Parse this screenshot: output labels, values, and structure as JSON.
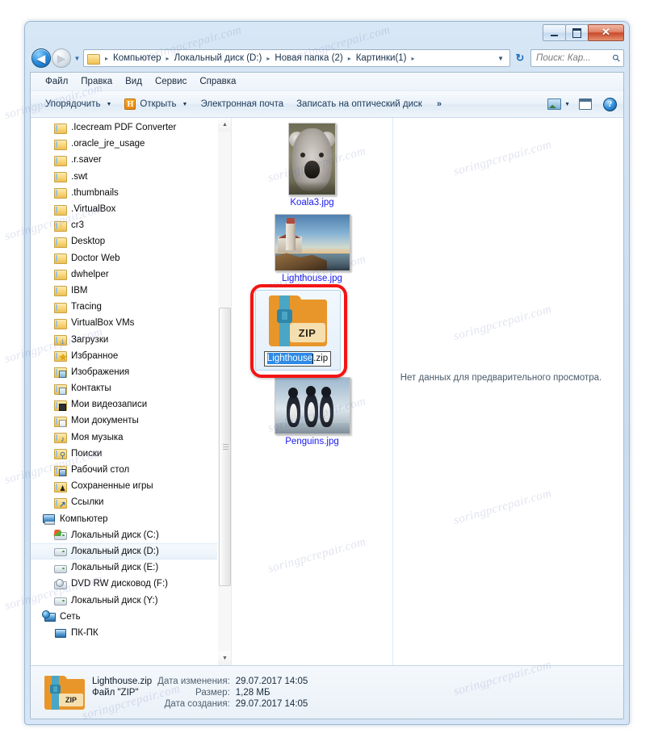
{
  "window": {
    "caption_buttons": {
      "minimize": "—",
      "maximize": "❐",
      "close": "✕"
    }
  },
  "address": {
    "back_arrow": "◀",
    "forward_arrow": "▶",
    "history_caret": "▼",
    "crumbs": [
      "Компьютер",
      "Локальный диск (D:)",
      "Новая папка (2)",
      "Картинки(1)"
    ],
    "separator": "▸",
    "dropdown_caret": "▼",
    "refresh_glyph": "↻"
  },
  "search": {
    "placeholder": "Поиск: Кар...",
    "icon": "⚲"
  },
  "menubar": {
    "items": [
      "Файл",
      "Правка",
      "Вид",
      "Сервис",
      "Справка"
    ]
  },
  "toolbar": {
    "organize_label": "Упорядочить",
    "open_label": "Открыть",
    "open_icon_letter": "H",
    "email_label": "Электронная почта",
    "burn_label": "Записать на оптический диск",
    "overflow": "»",
    "caret": "▼",
    "view_caret": "▼",
    "help_glyph": "?"
  },
  "nav_pane": {
    "items": [
      {
        "label": ".Icecream PDF Converter",
        "icon": "folder-icon",
        "level": 2,
        "selected": false
      },
      {
        "label": ".oracle_jre_usage",
        "icon": "folder-icon",
        "level": 2,
        "selected": false
      },
      {
        "label": ".r.saver",
        "icon": "folder-icon",
        "level": 2,
        "selected": false
      },
      {
        "label": ".swt",
        "icon": "folder-icon",
        "level": 2,
        "selected": false
      },
      {
        "label": ".thumbnails",
        "icon": "folder-icon",
        "level": 2,
        "selected": false
      },
      {
        "label": ".VirtualBox",
        "icon": "folder-icon",
        "level": 2,
        "selected": false
      },
      {
        "label": "cr3",
        "icon": "folder-icon",
        "level": 2,
        "selected": false
      },
      {
        "label": "Desktop",
        "icon": "folder-icon",
        "level": 2,
        "selected": false
      },
      {
        "label": "Doctor Web",
        "icon": "folder-icon",
        "level": 2,
        "selected": false
      },
      {
        "label": "dwhelper",
        "icon": "folder-icon",
        "level": 2,
        "selected": false
      },
      {
        "label": "IBM",
        "icon": "folder-icon",
        "level": 2,
        "selected": false
      },
      {
        "label": "Tracing",
        "icon": "folder-icon",
        "level": 2,
        "selected": false
      },
      {
        "label": "VirtualBox VMs",
        "icon": "folder-icon",
        "level": 2,
        "selected": false
      },
      {
        "label": "Загрузки",
        "icon": "downloads-folder-icon",
        "level": 2,
        "selected": false
      },
      {
        "label": "Избранное",
        "icon": "favorites-folder-icon",
        "level": 2,
        "selected": false
      },
      {
        "label": "Изображения",
        "icon": "pictures-folder-icon",
        "level": 2,
        "selected": false
      },
      {
        "label": "Контакты",
        "icon": "contacts-folder-icon",
        "level": 2,
        "selected": false
      },
      {
        "label": "Мои видеозаписи",
        "icon": "videos-folder-icon",
        "level": 2,
        "selected": false
      },
      {
        "label": "Мои документы",
        "icon": "documents-folder-icon",
        "level": 2,
        "selected": false
      },
      {
        "label": "Моя музыка",
        "icon": "music-folder-icon",
        "level": 2,
        "selected": false
      },
      {
        "label": "Поиски",
        "icon": "searches-folder-icon",
        "level": 2,
        "selected": false
      },
      {
        "label": "Рабочий стол",
        "icon": "desktop-folder-icon",
        "level": 2,
        "selected": false
      },
      {
        "label": "Сохраненные игры",
        "icon": "saved-games-folder-icon",
        "level": 2,
        "selected": false
      },
      {
        "label": "Ссылки",
        "icon": "links-folder-icon",
        "level": 2,
        "selected": false
      },
      {
        "label": "Компьютер",
        "icon": "computer-icon",
        "level": 1,
        "selected": false
      },
      {
        "label": "Локальный диск (C:)",
        "icon": "system-drive-icon",
        "level": 2,
        "selected": false
      },
      {
        "label": "Локальный диск (D:)",
        "icon": "drive-icon",
        "level": 2,
        "selected": true
      },
      {
        "label": "Локальный диск (E:)",
        "icon": "drive-icon",
        "level": 2,
        "selected": false
      },
      {
        "label": "DVD RW дисковод (F:)",
        "icon": "dvd-drive-icon",
        "level": 2,
        "selected": false
      },
      {
        "label": "Локальный диск (Y:)",
        "icon": "drive-icon",
        "level": 2,
        "selected": false
      },
      {
        "label": "Сеть",
        "icon": "network-icon",
        "level": 1,
        "selected": false
      },
      {
        "label": "ПК-ПК",
        "icon": "pc-icon",
        "level": 2,
        "selected": false
      }
    ],
    "scroll_up_glyph": "▲",
    "scroll_down_glyph": "▼"
  },
  "file_list": {
    "files": [
      {
        "name": "Koala3.jpg",
        "thumb": "koala-photo"
      },
      {
        "name": "Lighthouse.jpg",
        "thumb": "lighthouse-photo"
      },
      {
        "name": "Penguins.jpg",
        "thumb": "penguins-photo"
      }
    ],
    "renaming_item": {
      "icon": "zip-archive-icon",
      "icon_label": "ZIP",
      "selected_text": "Lighthouse",
      "extension_text": ".zip",
      "full_name": "Lighthouse.zip"
    }
  },
  "preview_pane": {
    "empty_message": "Нет данных для предварительного просмотра."
  },
  "details_bar": {
    "file_name": "Lighthouse.zip",
    "file_type": "Файл \"ZIP\"",
    "modified_key": "Дата изменения:",
    "modified_value": "29.07.2017 14:05",
    "size_key": "Размер:",
    "size_value": "1,28 МБ",
    "created_key": "Дата создания:",
    "created_value": "29.07.2017 14:05",
    "icon_label": "ZIP"
  },
  "watermark": {
    "text": "soringpcrepair.com"
  }
}
